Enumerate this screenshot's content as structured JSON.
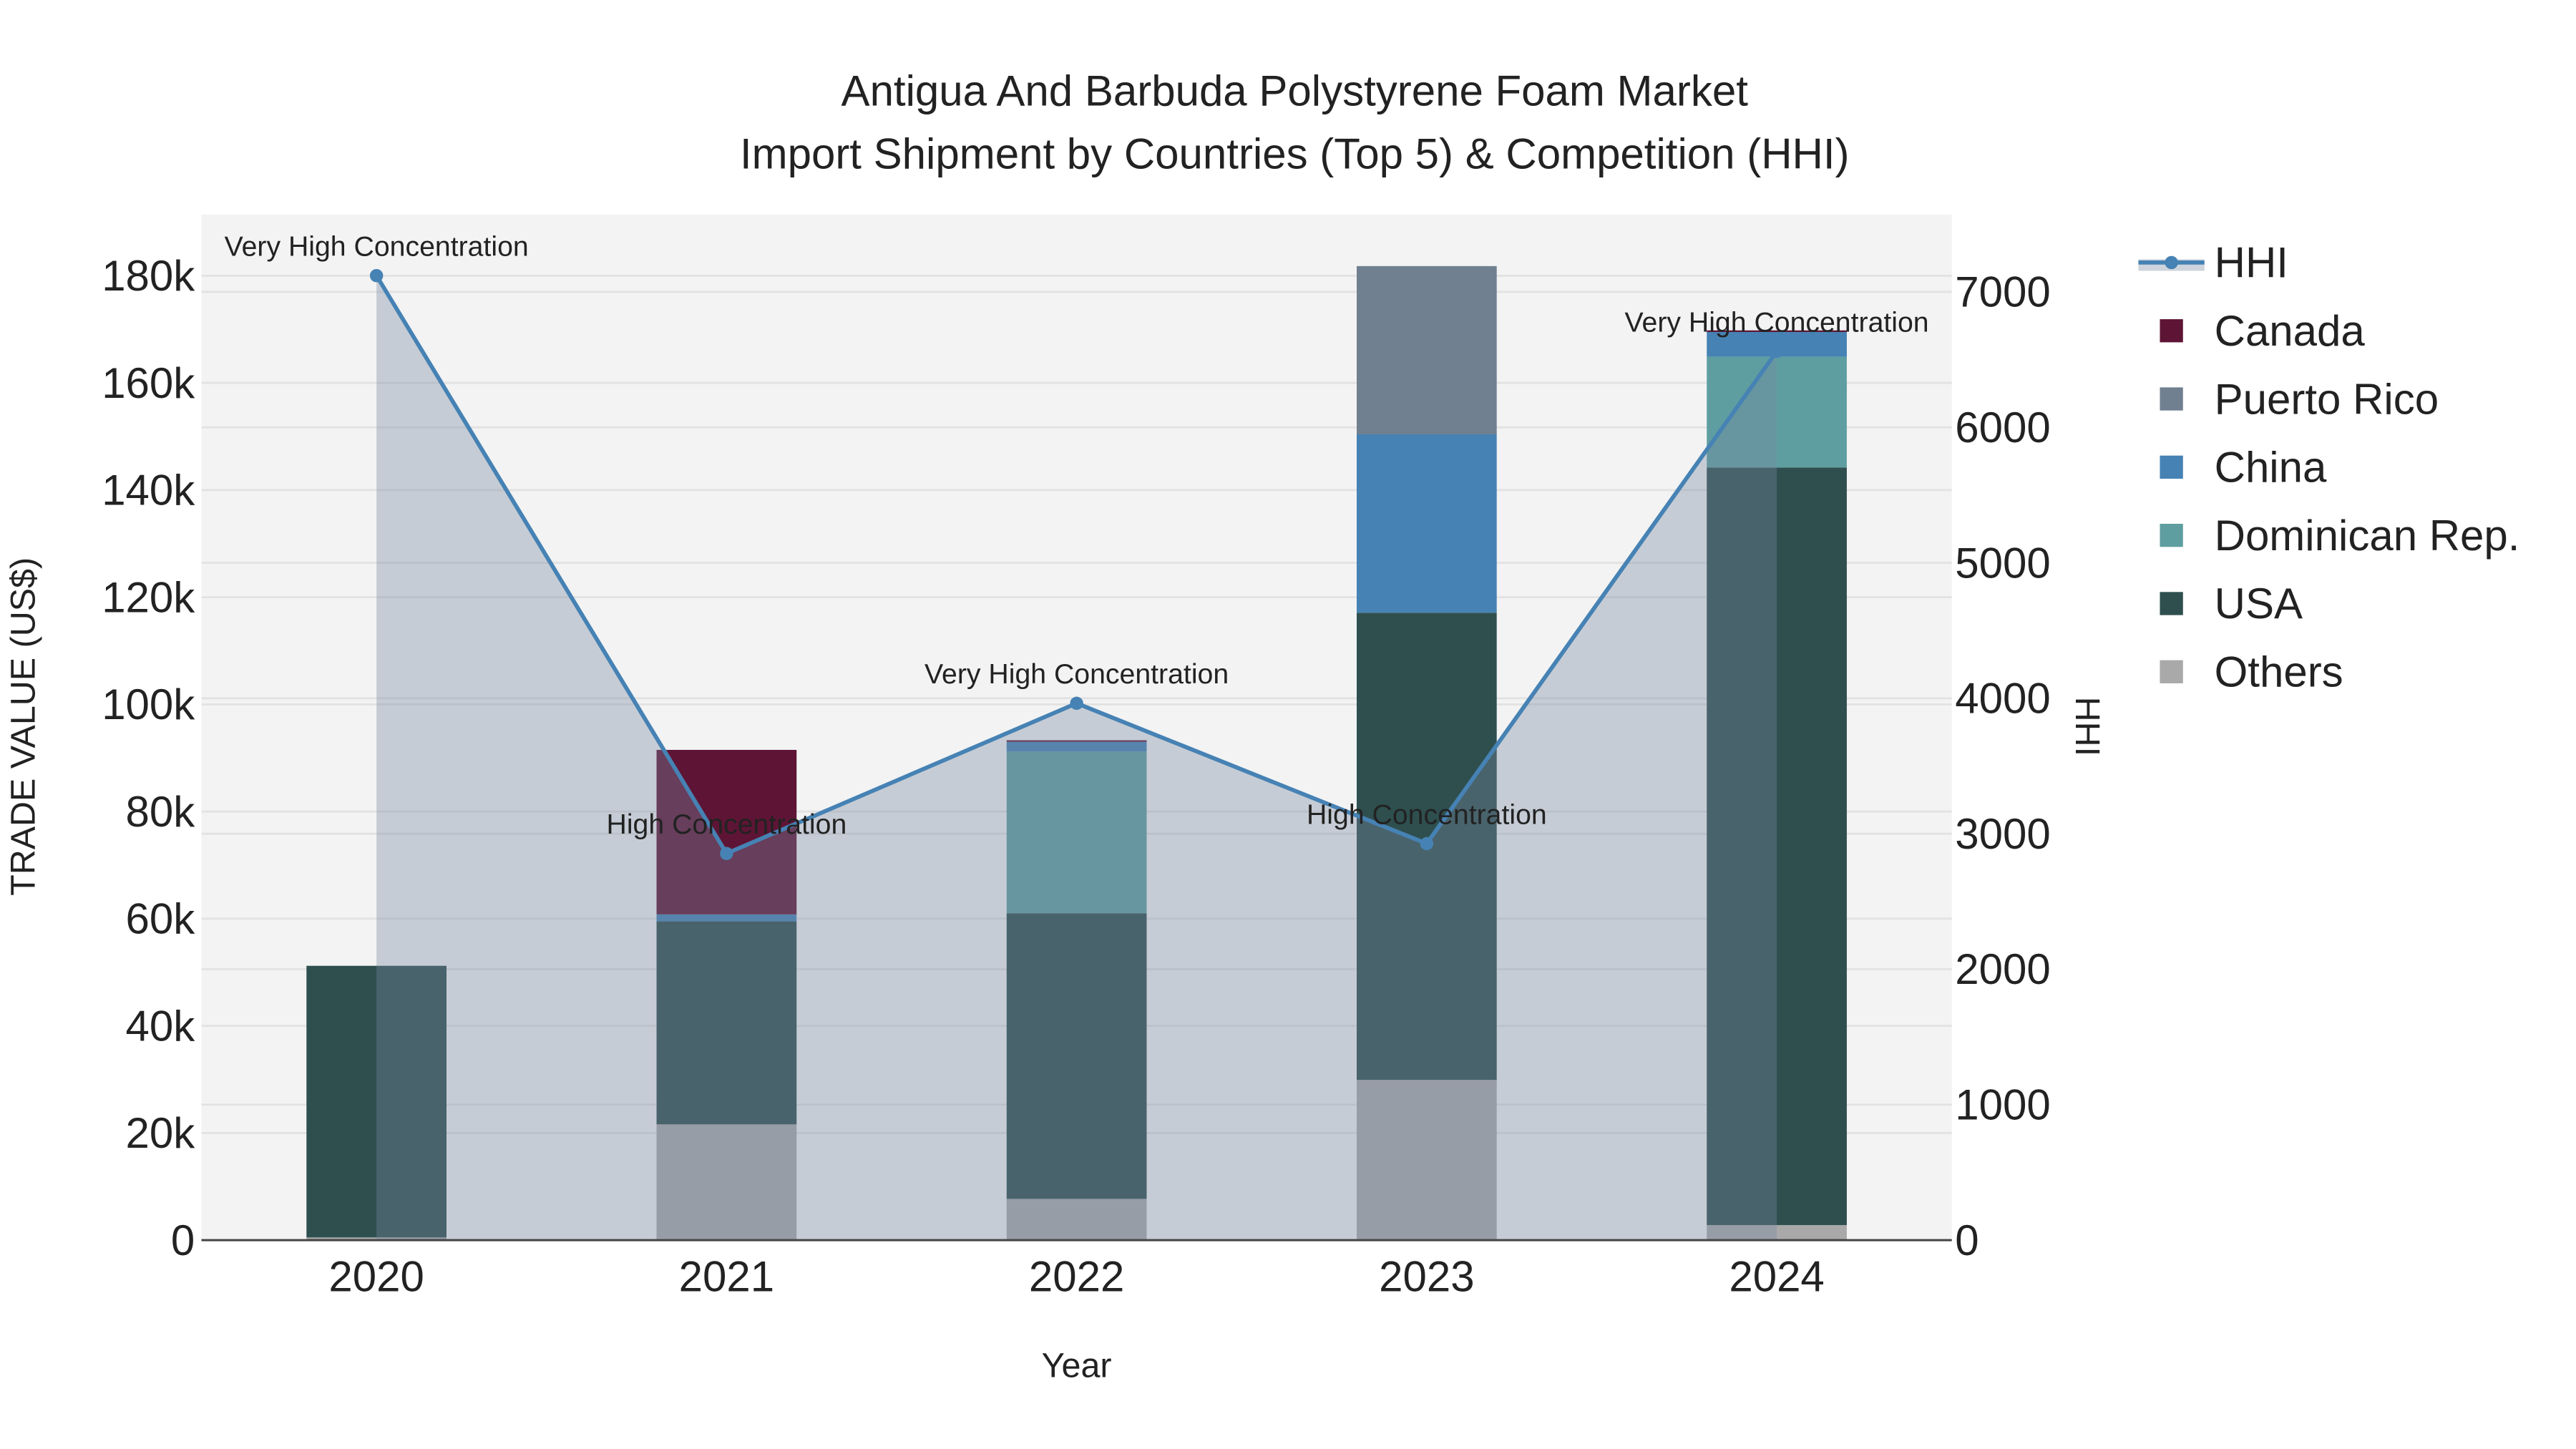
{
  "chart_data": {
    "type": "bar",
    "title_line1": "Antigua And Barbuda Polystyrene Foam Market",
    "title_line2": "Import Shipment by Countries (Top 5) & Competition (HHI)",
    "xlabel": "Year",
    "ylabel": "TRADE VALUE (US$)",
    "y2label": "HHI",
    "categories": [
      "2020",
      "2021",
      "2022",
      "2023",
      "2024"
    ],
    "ylim": [
      0,
      191400
    ],
    "y2lim": [
      0,
      7570
    ],
    "yticks": [
      0,
      20000,
      40000,
      60000,
      80000,
      100000,
      120000,
      140000,
      160000,
      180000
    ],
    "ytick_labels": [
      "0",
      "20k",
      "40k",
      "60k",
      "80k",
      "100k",
      "120k",
      "140k",
      "160k",
      "180k"
    ],
    "y2ticks": [
      0,
      1000,
      2000,
      3000,
      4000,
      5000,
      6000,
      7000
    ],
    "y2tick_labels": [
      "0",
      "1000",
      "2000",
      "3000",
      "4000",
      "5000",
      "6000",
      "7000"
    ],
    "grid": true,
    "legend_position": "right",
    "series": [
      {
        "name": "Others",
        "color": "#a9a9a9",
        "values": [
          500,
          21600,
          7700,
          29900,
          2800
        ]
      },
      {
        "name": "USA",
        "color": "#2f4f4f",
        "values": [
          50700,
          37900,
          53300,
          87200,
          141400
        ]
      },
      {
        "name": "Dominican Rep.",
        "color": "#5f9ea0",
        "values": [
          0,
          0,
          30200,
          0,
          20700
        ]
      },
      {
        "name": "China",
        "color": "#4682b4",
        "values": [
          0,
          1300,
          1800,
          33300,
          4600
        ]
      },
      {
        "name": "Puerto Rico",
        "color": "#708090",
        "values": [
          0,
          0,
          0,
          31400,
          0
        ]
      },
      {
        "name": "Canada",
        "color": "#5e1535",
        "values": [
          0,
          30700,
          300,
          0,
          300
        ]
      }
    ],
    "hhi": {
      "name": "HHI",
      "color": "#4682b4",
      "values": [
        7120,
        2854,
        3963,
        2927,
        6561
      ],
      "labels": [
        "Very High Concentration",
        "High Concentration",
        "Very High Concentration",
        "High Concentration",
        "Very High Concentration"
      ]
    },
    "legend": [
      "HHI",
      "Canada",
      "Puerto Rico",
      "China",
      "Dominican Rep.",
      "USA",
      "Others"
    ]
  }
}
